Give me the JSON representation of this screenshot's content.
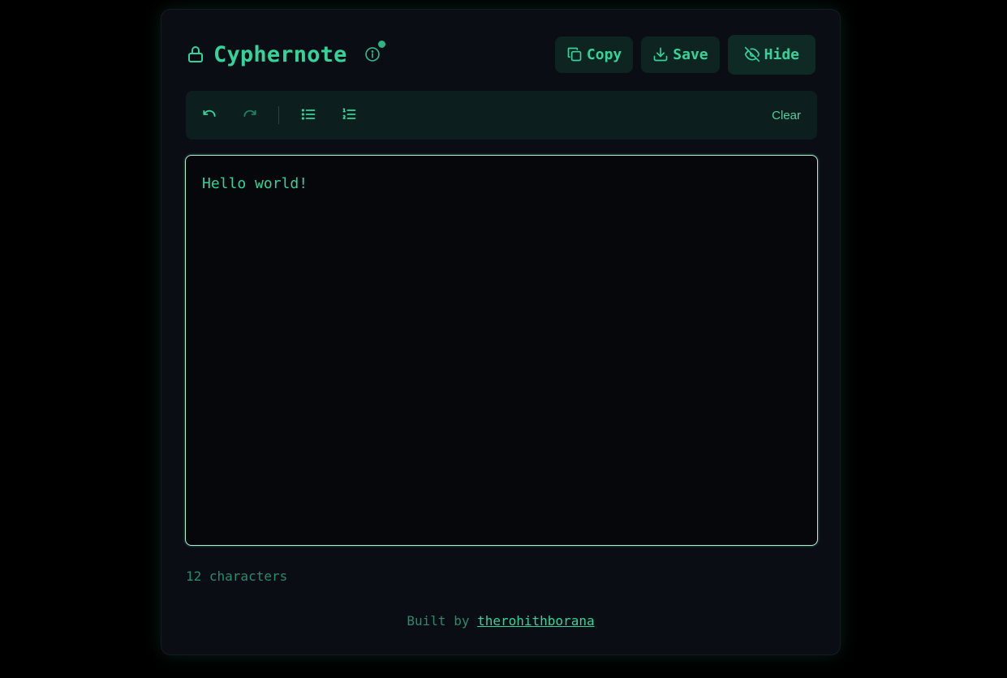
{
  "app": {
    "title": "Cyphernote"
  },
  "header": {
    "copy_label": "Copy",
    "save_label": "Save",
    "hide_label": "Hide"
  },
  "toolbar": {
    "clear_label": "Clear",
    "icons": [
      "undo-icon",
      "redo-icon",
      "bullet-list-icon",
      "numbered-list-icon"
    ]
  },
  "editor": {
    "content": "Hello world!"
  },
  "status": {
    "char_count": "12 characters"
  },
  "footer": {
    "prefix": "Built by",
    "author": "therohithborana"
  },
  "colors": {
    "accent": "#34d399",
    "background": "#000000",
    "card": "#0a0d14",
    "editor_border": "#a7f3d0"
  }
}
